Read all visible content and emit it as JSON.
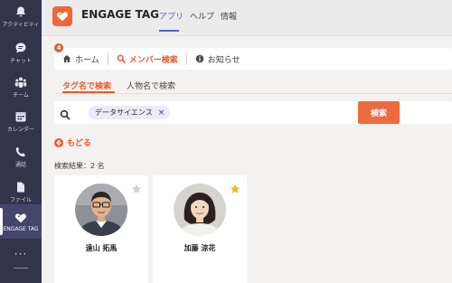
{
  "rail": {
    "items": [
      {
        "label": "アクティビティ",
        "icon": "bell-icon"
      },
      {
        "label": "チャット",
        "icon": "chat-icon"
      },
      {
        "label": "チーム",
        "icon": "teams-icon"
      },
      {
        "label": "カレンダー",
        "icon": "calendar-icon"
      },
      {
        "label": "通話",
        "icon": "phone-icon"
      },
      {
        "label": "ファイル",
        "icon": "file-icon"
      },
      {
        "label": "ENGAGE TAG",
        "icon": "engage-tag-icon"
      }
    ],
    "more_label": "···"
  },
  "header": {
    "app_name": "ENGAGE TAG",
    "tabs": [
      {
        "label": "アプリ"
      },
      {
        "label": "ヘルプ"
      },
      {
        "label": "情報"
      }
    ]
  },
  "nav": {
    "badge_count": "4",
    "items": [
      {
        "label": "ホーム",
        "icon": "home-icon"
      },
      {
        "label": "メンバー検索",
        "icon": "search-icon"
      },
      {
        "label": "お知らせ",
        "icon": "info-icon"
      }
    ]
  },
  "subtabs": [
    {
      "label": "タグ名で検索"
    },
    {
      "label": "人物名で検索"
    }
  ],
  "search": {
    "chip_label": "データサイエンス",
    "chip_remove": "×",
    "button_label": "検索"
  },
  "back_label": "もどる",
  "results": {
    "count_label": "検索結果：2 名",
    "members": [
      {
        "name": "遠山 拓馬",
        "favorited": false
      },
      {
        "name": "加藤 涼花",
        "favorited": true
      }
    ]
  },
  "colors": {
    "accent": "#e65a2e",
    "rail": "#33344a",
    "teams_purple": "#5b5fc7",
    "chip_bg": "#ebe9fb",
    "star_on": "#f4b72c",
    "star_off": "#d2d0ce"
  }
}
